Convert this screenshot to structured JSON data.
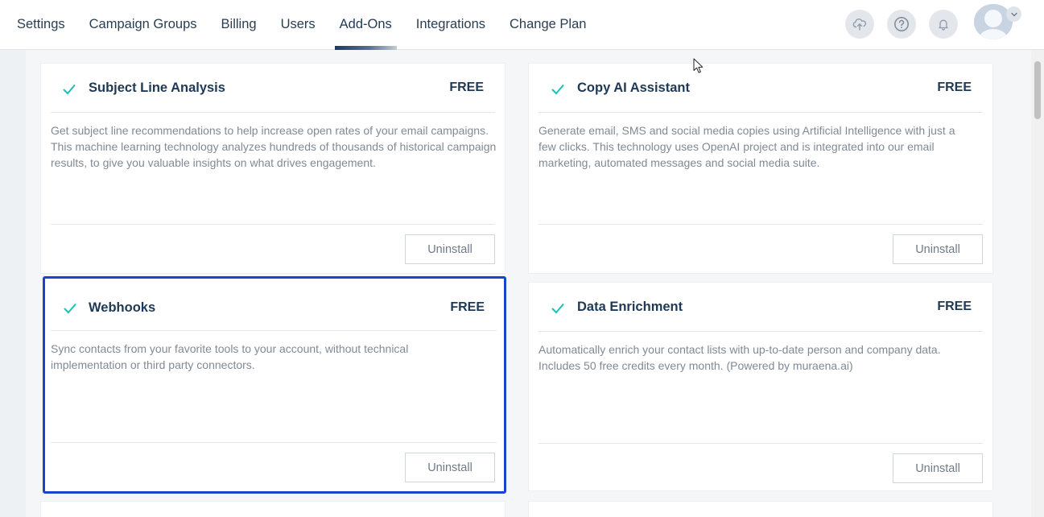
{
  "nav": {
    "items": [
      {
        "label": "Settings"
      },
      {
        "label": "Campaign Groups"
      },
      {
        "label": "Billing"
      },
      {
        "label": "Users"
      },
      {
        "label": "Add-Ons",
        "active": true
      },
      {
        "label": "Integrations"
      },
      {
        "label": "Change Plan"
      }
    ]
  },
  "header_icons": [
    "cloud-upload-icon",
    "help-icon",
    "bell-icon",
    "avatar",
    "chevron-down-icon"
  ],
  "addons": [
    {
      "title": "Subject Line Analysis",
      "price": "FREE",
      "description": "Get subject line recommendations to help increase open rates of your email campaigns. This machine learning technology analyzes hundreds of thousands of historical campaign results, to give you valuable insights on what drives engagement.",
      "button": "Uninstall",
      "installed": true
    },
    {
      "title": "Copy AI Assistant",
      "price": "FREE",
      "description": "Generate email, SMS and social media copies using Artificial Intelligence with just a few clicks. This technology uses OpenAI project and is integrated into our email marketing, automated messages and social media suite.",
      "button": "Uninstall",
      "installed": true
    },
    {
      "title": "Webhooks",
      "price": "FREE",
      "description": "Sync contacts from your favorite tools to your account, without technical implementation or third party connectors.",
      "button": "Uninstall",
      "installed": true,
      "selected": true
    },
    {
      "title": "Data Enrichment",
      "price": "FREE",
      "description": "Automatically enrich your contact lists with up-to-date person and company data. Includes 50 free credits every month. (Powered by muraena.ai)",
      "button": "Uninstall",
      "installed": true
    }
  ],
  "colors": {
    "check": "#19c3b3",
    "selected_border": "#1746c9",
    "title": "#1e3956",
    "description": "#808a95",
    "nav_active_underline": "#1f3a66"
  }
}
